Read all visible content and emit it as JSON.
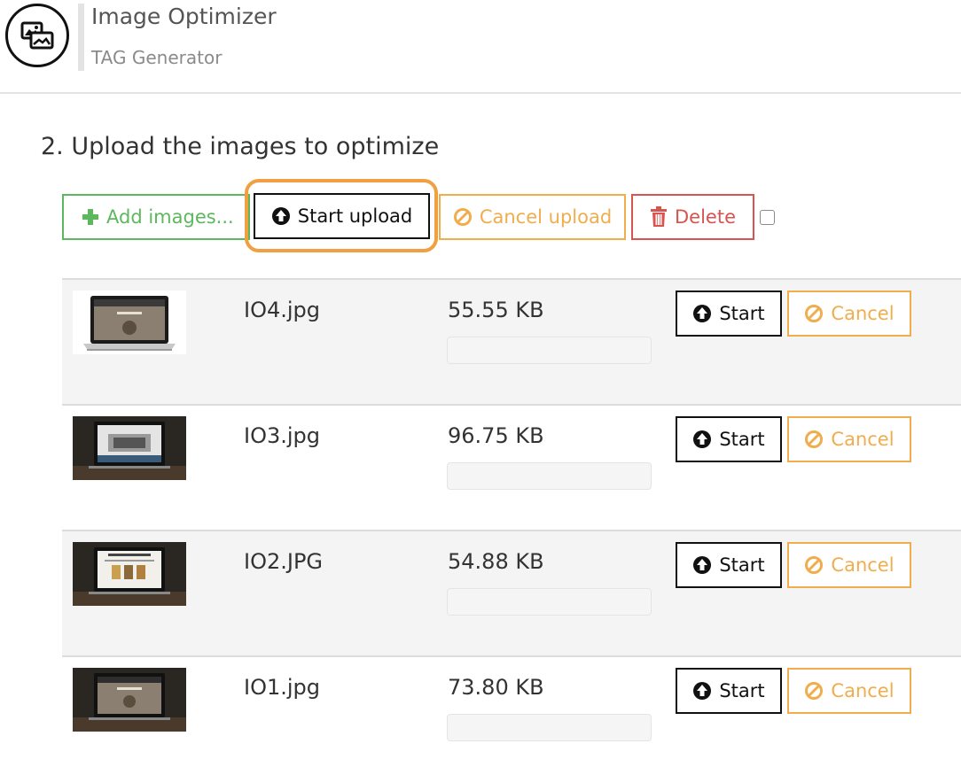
{
  "header": {
    "app_title": "Image Optimizer",
    "app_subtitle": "TAG Generator",
    "logo_icon": "images-icon"
  },
  "section_title": "2. Upload the images to optimize",
  "toolbar": {
    "add_label": "Add images...",
    "start_upload_label": "Start upload",
    "cancel_upload_label": "Cancel upload",
    "delete_label": "Delete",
    "select_all_checked": false
  },
  "colors": {
    "success": "#5cb85c",
    "warning": "#f0ad4e",
    "danger": "#d9534f",
    "highlight": "#f0a040"
  },
  "files": [
    {
      "name": "IO4.jpg",
      "size": "55.55 KB",
      "progress": 0,
      "start_label": "Start",
      "cancel_label": "Cancel"
    },
    {
      "name": "IO3.jpg",
      "size": "96.75 KB",
      "progress": 0,
      "start_label": "Start",
      "cancel_label": "Cancel"
    },
    {
      "name": "IO2.JPG",
      "size": "54.88 KB",
      "progress": 0,
      "start_label": "Start",
      "cancel_label": "Cancel"
    },
    {
      "name": "IO1.jpg",
      "size": "73.80 KB",
      "progress": 0,
      "start_label": "Start",
      "cancel_label": "Cancel"
    }
  ]
}
